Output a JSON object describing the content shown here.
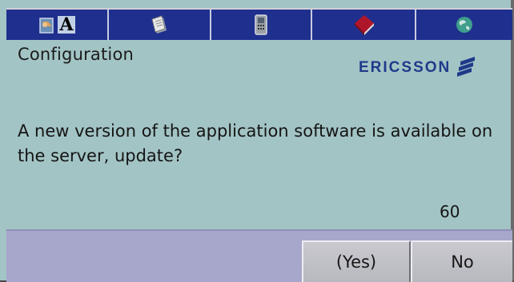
{
  "tabs": [
    {
      "icon": "address-book-icon",
      "label": "A"
    },
    {
      "icon": "documents-icon"
    },
    {
      "icon": "phone-icon"
    },
    {
      "icon": "book-icon"
    },
    {
      "icon": "globe-icon"
    }
  ],
  "dialog": {
    "title": "Configuration",
    "brand": "ERICSSON",
    "message": "A new version of the application software is available on the server, update?",
    "countdown": "60"
  },
  "softkeys": {
    "yes_label": "(Yes)",
    "no_label": "No"
  },
  "colors": {
    "background": "#a3c4c5",
    "tabbar": "#1f2f8e",
    "softbar": "#a7a6cb",
    "brand": "#1f3a8a"
  }
}
